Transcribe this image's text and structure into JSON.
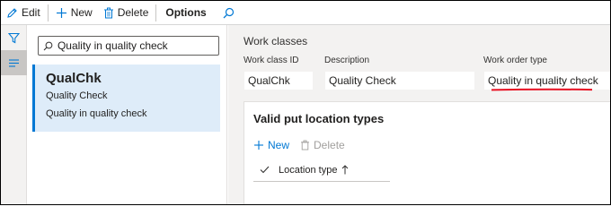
{
  "toolbar": {
    "edit_label": "Edit",
    "new_label": "New",
    "delete_label": "Delete",
    "options_label": "Options"
  },
  "list": {
    "search_value": "Quality in quality check",
    "items": [
      {
        "title": "QualChk",
        "subtitle": "Quality Check",
        "detail": "Quality in quality check"
      }
    ]
  },
  "detail": {
    "section": "Work classes",
    "fields": {
      "work_class_id_label": "Work class ID",
      "work_class_id_value": "QualChk",
      "description_label": "Description",
      "description_value": "Quality Check",
      "work_order_type_label": "Work order type",
      "work_order_type_value": "Quality in quality check"
    },
    "card": {
      "title": "Valid put location types",
      "new_label": "New",
      "delete_label": "Delete",
      "column_header": "Location type"
    }
  },
  "colors": {
    "accent": "#0078d4",
    "selection": "#deecf9",
    "annotation": "#e81123"
  }
}
